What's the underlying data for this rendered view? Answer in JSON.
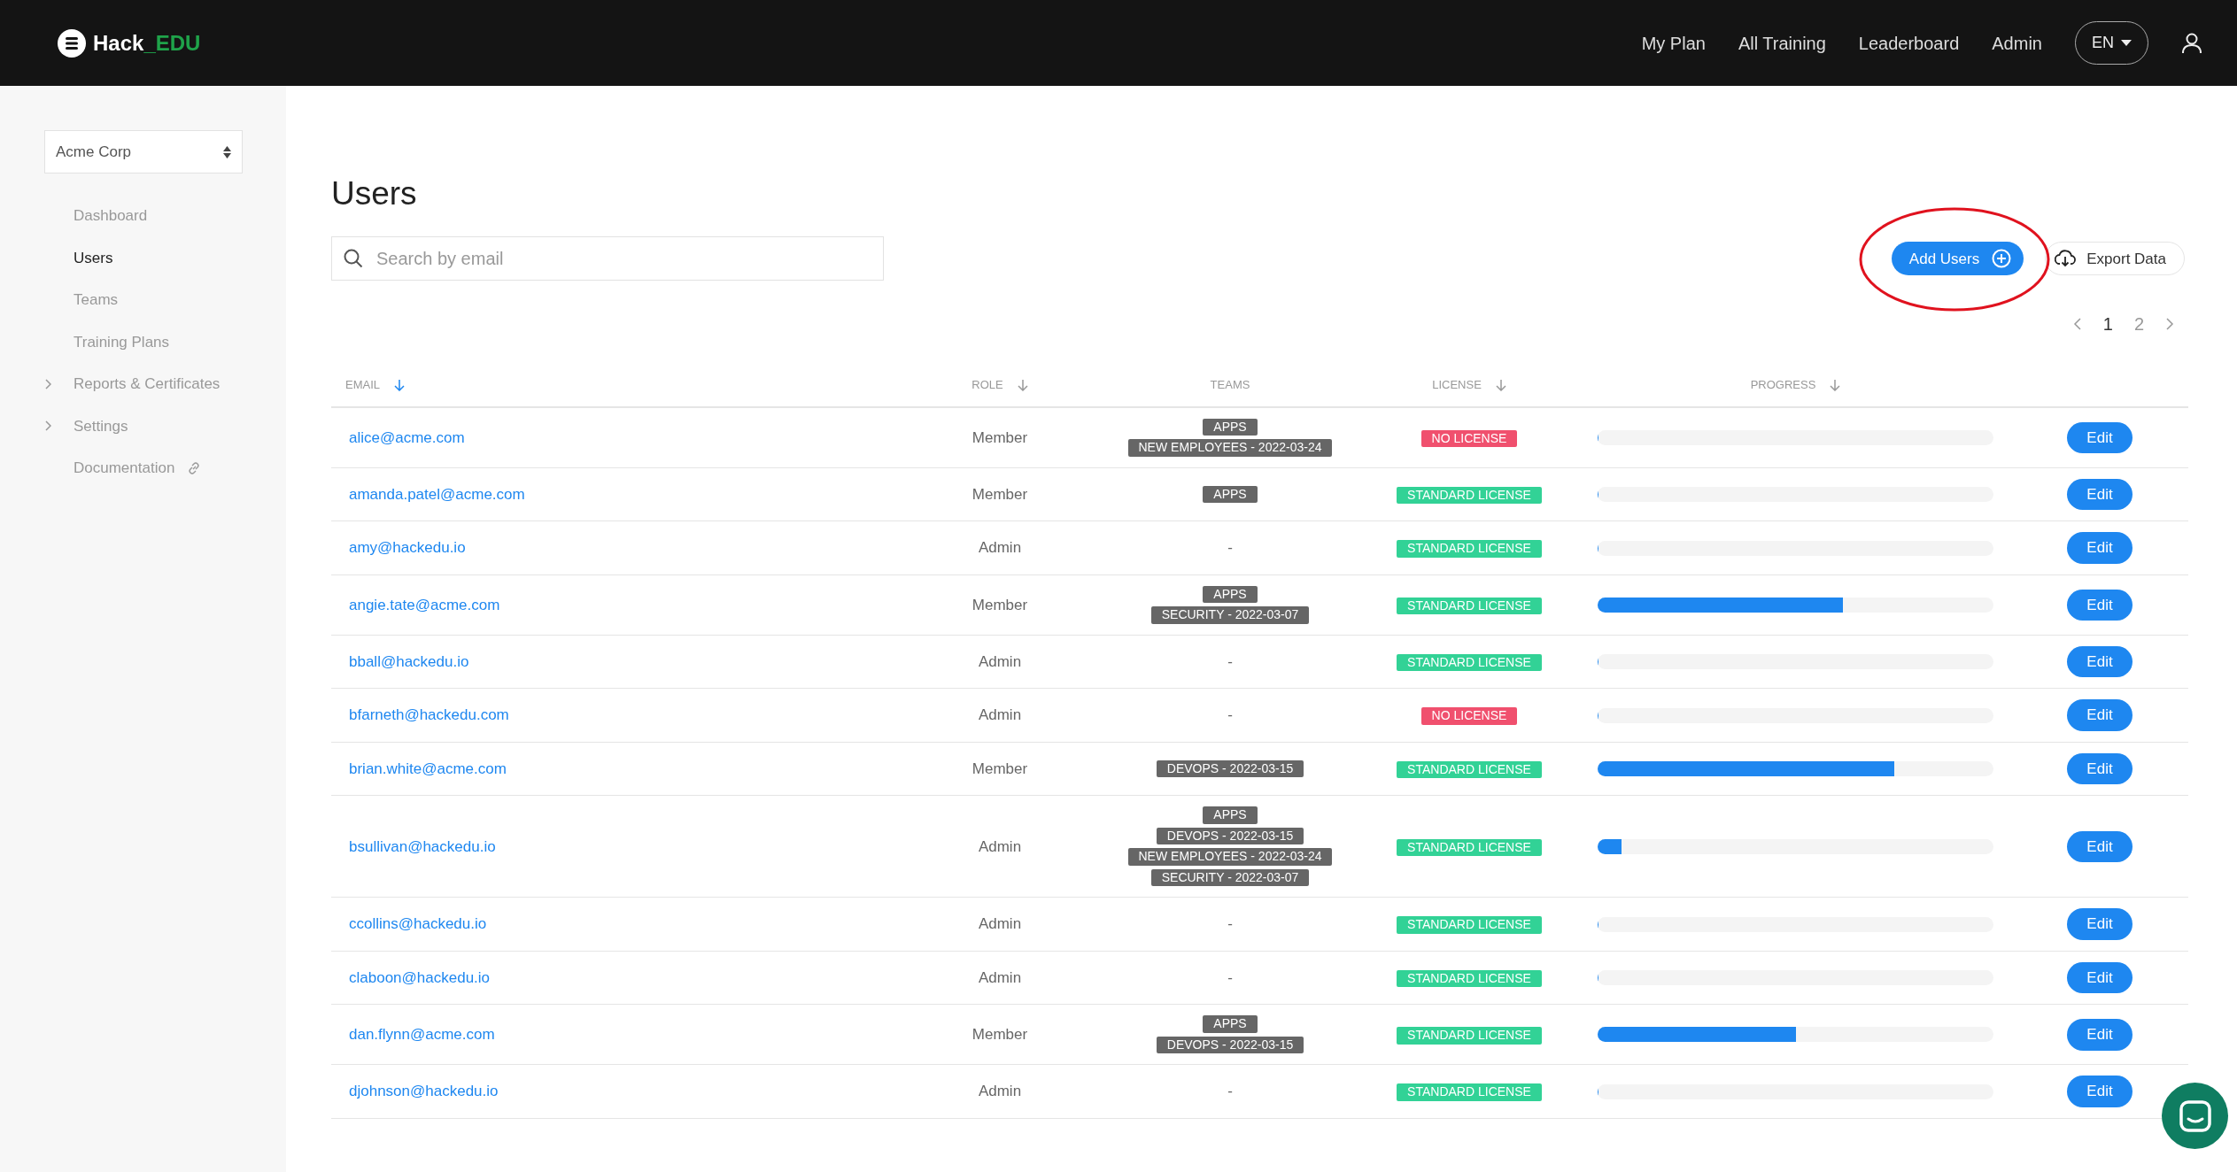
{
  "navbar": {
    "logo": {
      "name": "Hack",
      "suffix": "_EDU"
    },
    "links": [
      "My Plan",
      "All Training",
      "Leaderboard",
      "Admin"
    ],
    "language": "EN"
  },
  "sidebar": {
    "organization": "Acme Corp",
    "items": [
      {
        "label": "Dashboard",
        "kind": "link",
        "selected": false
      },
      {
        "label": "Users",
        "kind": "link",
        "selected": true
      },
      {
        "label": "Teams",
        "kind": "link",
        "selected": false
      },
      {
        "label": "Training Plans",
        "kind": "link",
        "selected": false
      },
      {
        "label": "Reports & Certificates",
        "kind": "group",
        "selected": false
      },
      {
        "label": "Settings",
        "kind": "group",
        "selected": false
      },
      {
        "label": "Documentation",
        "kind": "external",
        "selected": false
      }
    ]
  },
  "page": {
    "title": "Users",
    "search": {
      "placeholder": "Search by email"
    },
    "buttons": [
      {
        "label": "Add Users",
        "kind": "primary"
      },
      {
        "label": "Export Data",
        "kind": "export"
      }
    ],
    "pagination": [
      {
        "label": "1",
        "selected": true
      },
      {
        "label": "2",
        "selected": false
      }
    ]
  },
  "table": {
    "columns": [
      {
        "label": "EMAIL",
        "sortable": true
      },
      {
        "label": "ROLE",
        "sortable": true
      },
      {
        "label": "TEAMS",
        "sortable": false
      },
      {
        "label": "LICENSE",
        "sortable": true
      },
      {
        "label": "PROGRESS",
        "sortable": true
      }
    ],
    "rows": [
      {
        "email": "alice@acme.com",
        "role": "Member",
        "teams": [
          "APPS",
          "NEW EMPLOYEES - 2022-03-24"
        ],
        "license": {
          "label": "NO LICENSE",
          "kind": "none"
        },
        "level": 0,
        "action": "Edit"
      },
      {
        "email": "amanda.patel@acme.com",
        "role": "Member",
        "teams": [
          "APPS"
        ],
        "license": {
          "label": "STANDARD LICENSE",
          "kind": "standard"
        },
        "level": 0,
        "action": "Edit"
      },
      {
        "email": "amy@hackedu.io",
        "role": "Admin",
        "no_team": "-",
        "license": {
          "label": "STANDARD LICENSE",
          "kind": "standard"
        },
        "level": 0,
        "action": "Edit"
      },
      {
        "email": "angie.tate@acme.com",
        "role": "Member",
        "teams": [
          "APPS",
          "SECURITY - 2022-03-07"
        ],
        "license": {
          "label": "STANDARD LICENSE",
          "kind": "standard"
        },
        "level": 0.62,
        "action": "Edit"
      },
      {
        "email": "bball@hackedu.io",
        "role": "Admin",
        "no_team": "-",
        "license": {
          "label": "STANDARD LICENSE",
          "kind": "standard"
        },
        "level": 0,
        "action": "Edit"
      },
      {
        "email": "bfarneth@hackedu.com",
        "role": "Admin",
        "no_team": "-",
        "license": {
          "label": "NO LICENSE",
          "kind": "none"
        },
        "level": 0,
        "action": "Edit"
      },
      {
        "email": "brian.white@acme.com",
        "role": "Member",
        "teams": [
          "DEVOPS - 2022-03-15"
        ],
        "license": {
          "label": "STANDARD LICENSE",
          "kind": "standard"
        },
        "level": 0.75,
        "action": "Edit"
      },
      {
        "email": "bsullivan@hackedu.io",
        "role": "Admin",
        "teams": [
          "APPS",
          "DEVOPS - 2022-03-15",
          "NEW EMPLOYEES - 2022-03-24",
          "SECURITY - 2022-03-07"
        ],
        "license": {
          "label": "STANDARD LICENSE",
          "kind": "standard"
        },
        "level": 0.06,
        "action": "Edit"
      },
      {
        "email": "ccollins@hackedu.io",
        "role": "Admin",
        "no_team": "-",
        "license": {
          "label": "STANDARD LICENSE",
          "kind": "standard"
        },
        "level": 0,
        "action": "Edit"
      },
      {
        "email": "claboon@hackedu.io",
        "role": "Admin",
        "no_team": "-",
        "license": {
          "label": "STANDARD LICENSE",
          "kind": "standard"
        },
        "level": 0,
        "action": "Edit"
      },
      {
        "email": "dan.flynn@acme.com",
        "role": "Member",
        "teams": [
          "APPS",
          "DEVOPS - 2022-03-15"
        ],
        "license": {
          "label": "STANDARD LICENSE",
          "kind": "standard"
        },
        "level": 0.5,
        "action": "Edit"
      },
      {
        "email": "djohnson@hackedu.io",
        "role": "Admin",
        "no_team": "-",
        "license": {
          "label": "STANDARD LICENSE",
          "kind": "standard"
        },
        "level": 0,
        "action": "Edit"
      }
    ]
  }
}
